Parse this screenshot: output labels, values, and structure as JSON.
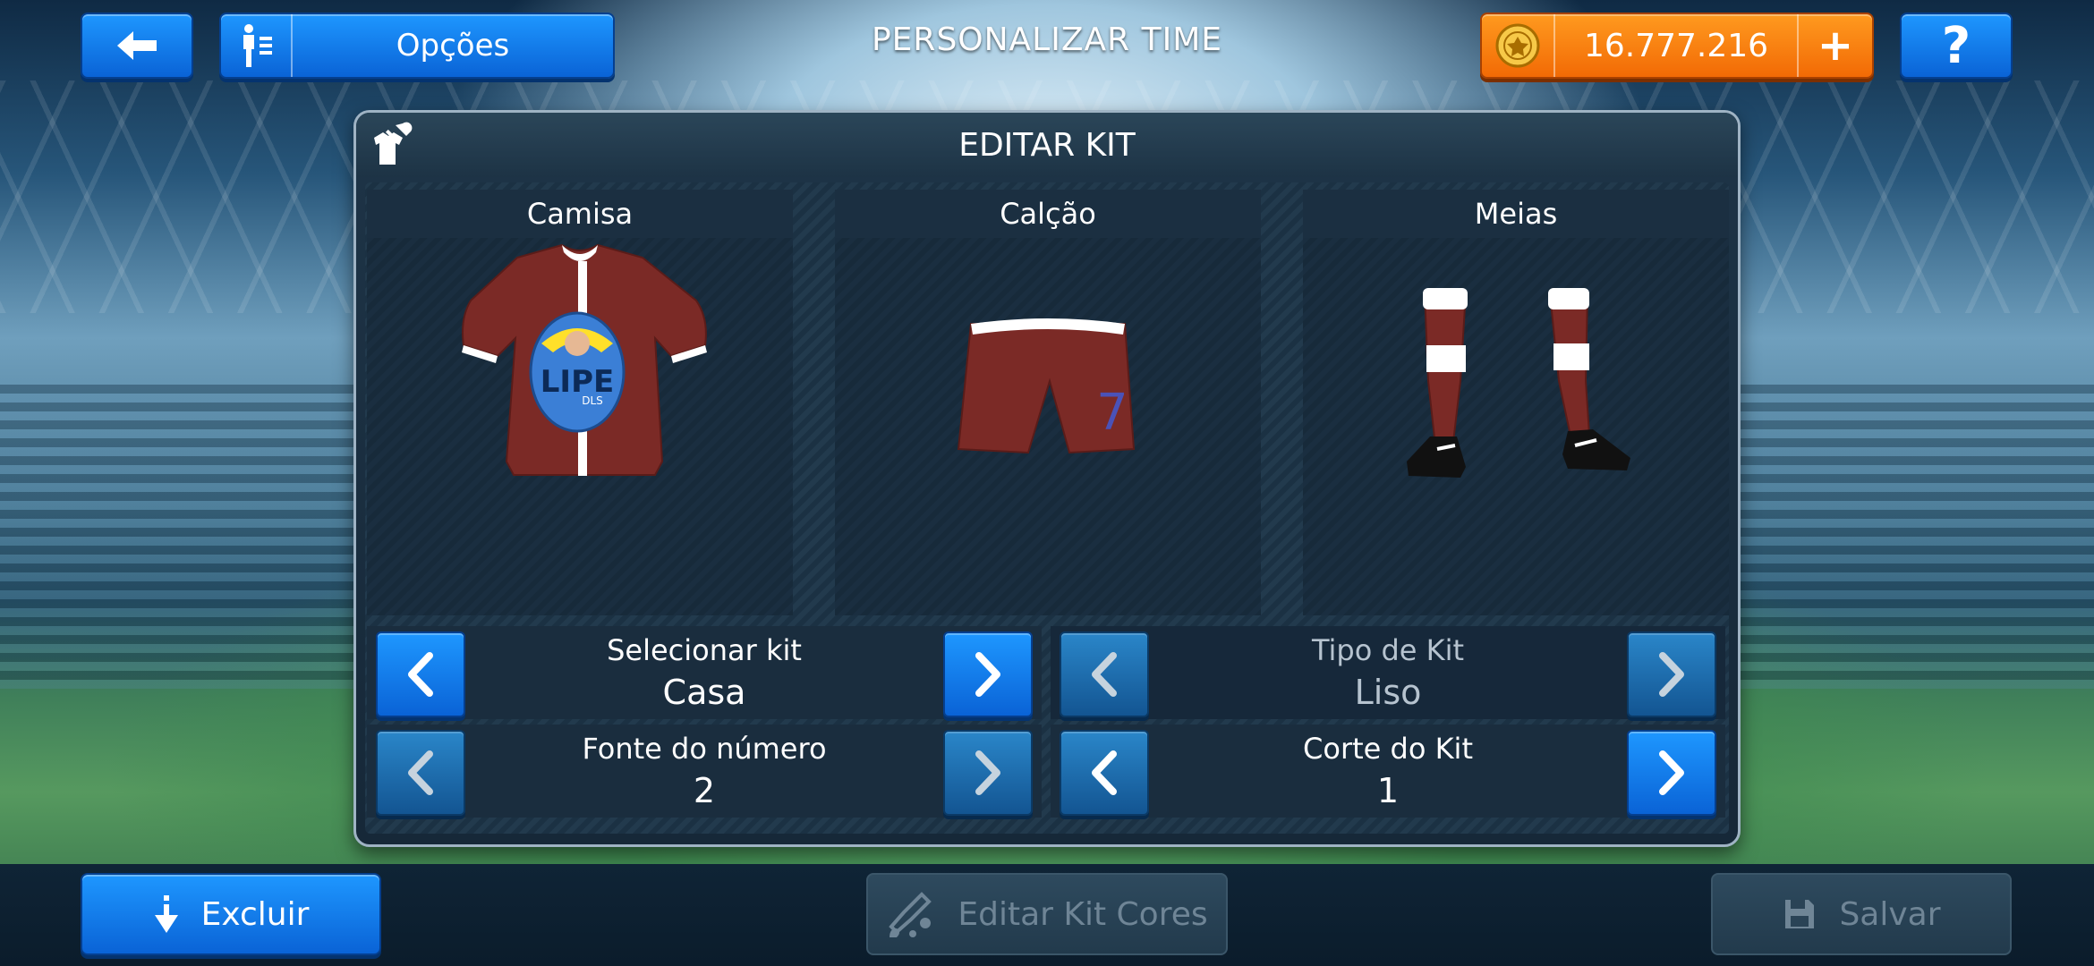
{
  "topbar": {
    "options_label": "Opções",
    "page_title": "PERSONALIZAR TIME",
    "coins": "16.777.216",
    "help_label": "?"
  },
  "panel": {
    "title": "EDITAR KIT",
    "columns": [
      {
        "title": "Camisa"
      },
      {
        "title": "Calção"
      },
      {
        "title": "Meias"
      }
    ],
    "shirt_logo_text": "LIPE",
    "shirt_logo_sub": "DLS",
    "shorts_number": "7",
    "controls": [
      {
        "label": "Selecionar kit",
        "value": "Casa"
      },
      {
        "label": "Tipo de Kit",
        "value": "Liso"
      },
      {
        "label": "Fonte do número",
        "value": "2"
      },
      {
        "label": "Corte do Kit",
        "value": "1"
      }
    ]
  },
  "bottombar": {
    "delete_label": "Excluir",
    "edit_colors_label": "Editar Kit Cores",
    "save_label": "Salvar"
  },
  "colors": {
    "kit_primary": "#7b2a26",
    "kit_secondary": "#ffffff",
    "button_blue": "#0a63d6",
    "coin_orange": "#f26a05"
  }
}
